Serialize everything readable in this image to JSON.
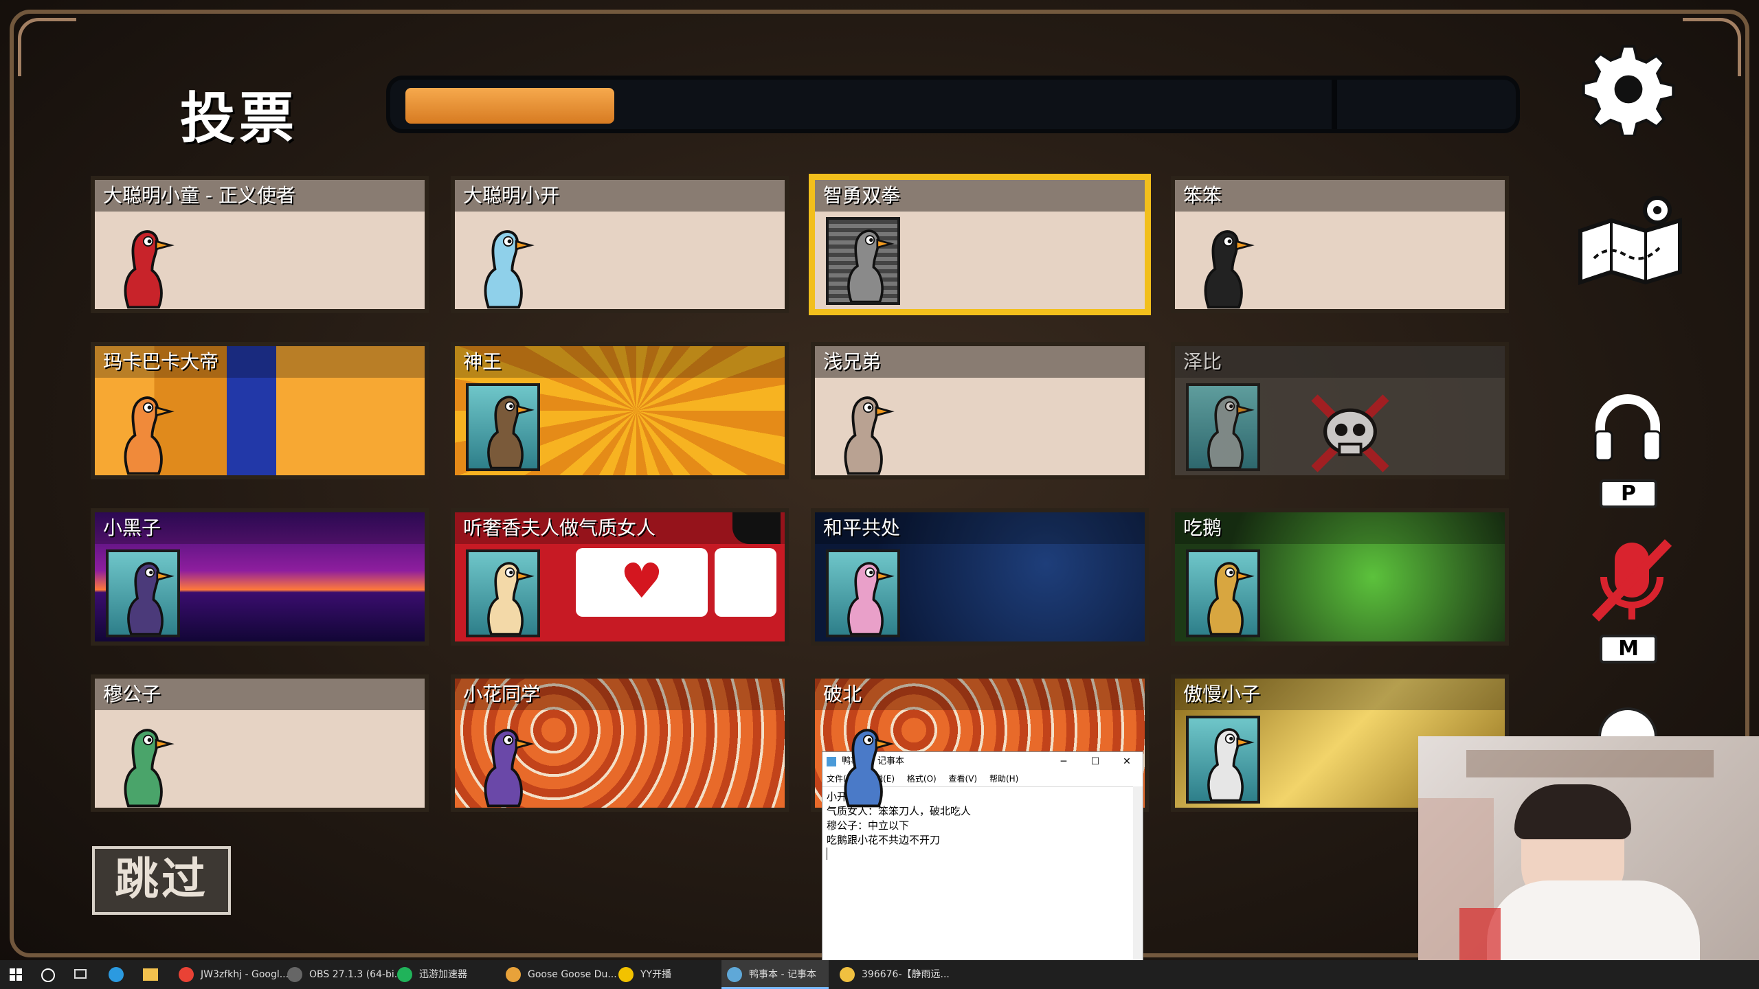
{
  "vote": {
    "title": "投票",
    "progress": 0.18
  },
  "players": [
    {
      "name": "大聪明小童 - 正义使者",
      "bg": "plain",
      "goose": "#c8232a",
      "selected": false
    },
    {
      "name": "大聪明小开",
      "bg": "plain",
      "goose": "#8fd0ea",
      "selected": false
    },
    {
      "name": "智勇双拳",
      "bg": "plain",
      "goose": "#8a8a8a",
      "selected": true
    },
    {
      "name": "笨笨",
      "bg": "plain",
      "goose": "#222222",
      "selected": false
    },
    {
      "name": "玛卡巴卡大帝",
      "bg": "space-earth",
      "goose": "#f08a3a",
      "selected": false
    },
    {
      "name": "神王",
      "bg": "knife",
      "goose": "#7a5a3a",
      "selected": false
    },
    {
      "name": "浅兄弟",
      "bg": "plain",
      "goose": "#b9a292",
      "selected": false
    },
    {
      "name": "泽比",
      "bg": "dead",
      "goose": "#9aa",
      "selected": false
    },
    {
      "name": "小黑子",
      "bg": "synthwave",
      "goose": "#4b3a7a",
      "selected": false
    },
    {
      "name": "听奢香夫人做气质女人",
      "bg": "like",
      "goose": "#f3d9a8",
      "selected": false
    },
    {
      "name": "和平共处",
      "bg": "stars",
      "goose": "#e9a0c9",
      "selected": false
    },
    {
      "name": "吃鹅",
      "bg": "monster",
      "goose": "#d8a640",
      "selected": false
    },
    {
      "name": "穆公子",
      "bg": "plain",
      "goose": "#4aa46a",
      "selected": false
    },
    {
      "name": "小花同学",
      "bg": "meat",
      "goose": "#6a48a8",
      "selected": false
    },
    {
      "name": "破北",
      "bg": "meat",
      "goose": "#4a7ac8",
      "selected": false
    },
    {
      "name": "傲慢小子",
      "bg": "gold",
      "goose": "#e6e6e6",
      "selected": false
    }
  ],
  "side": {
    "settings_icon": "gear-icon",
    "map_icon": "map-icon",
    "talk_key": "P",
    "mute_key": "M"
  },
  "skip_label": "跳过",
  "notepad": {
    "title": "鸭事本 - 记事本",
    "menu": [
      "文件(F)",
      "编辑(E)",
      "格式(O)",
      "查看(V)",
      "帮助(H)"
    ],
    "lines": [
      "小开：网红",
      "气质女人：笨笨刀人，破北吃人",
      "穆公子：中立以下",
      "吃鹅跟小花不共边不开刀"
    ]
  },
  "taskbar": [
    {
      "label": "JW3zfkhj - Googl...",
      "color": "#e94235"
    },
    {
      "label": "OBS 27.1.3 (64-bi...",
      "color": "#666666"
    },
    {
      "label": "迅游加速器",
      "color": "#20b35a"
    },
    {
      "label": "Goose Goose Du...",
      "color": "#e8a23a"
    },
    {
      "label": "YY开播",
      "color": "#f2c200"
    },
    {
      "label": "鸭事本 - 记事本",
      "color": "#5fa8d8"
    },
    {
      "label": "396676-【静雨远...",
      "color": "#f0c040"
    }
  ]
}
